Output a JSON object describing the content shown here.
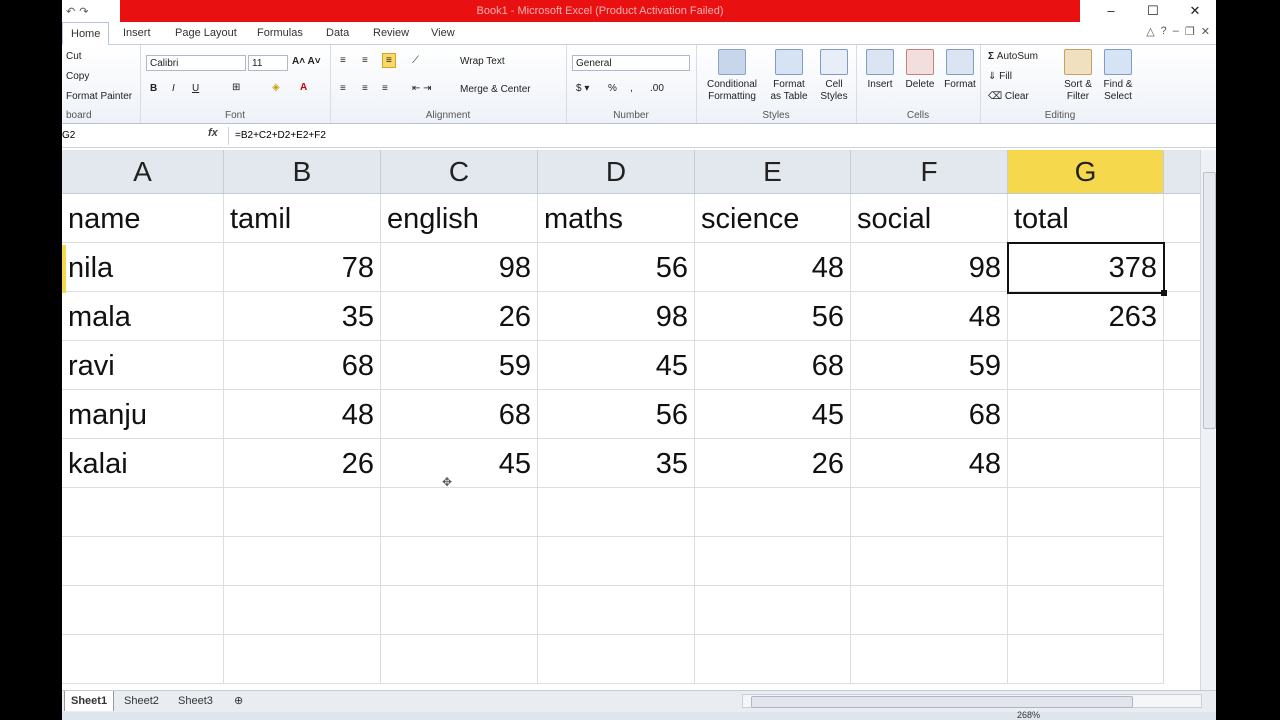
{
  "window": {
    "title": "Book1 - Microsoft Excel (Product Activation Failed)"
  },
  "qat": {
    "undo": "↶",
    "redo": "↷"
  },
  "tabs": [
    "Home",
    "Insert",
    "Page Layout",
    "Formulas",
    "Data",
    "Review",
    "View"
  ],
  "clipboard": {
    "cut": "Cut",
    "copy": "Copy",
    "format_painter": "Format Painter",
    "label": "board"
  },
  "font": {
    "name": "Calibri",
    "size": "11",
    "label": "Font"
  },
  "alignment": {
    "wrap": "Wrap Text",
    "merge": "Merge & Center",
    "label": "Alignment"
  },
  "number": {
    "format": "General",
    "label": "Number"
  },
  "styles": {
    "cond": [
      "Conditional",
      "Formatting"
    ],
    "table": [
      "Format",
      "as Table"
    ],
    "cell": [
      "Cell",
      "Styles"
    ],
    "label": "Styles"
  },
  "cells": {
    "insert": "Insert",
    "delete": "Delete",
    "format": "Format",
    "label": "Cells"
  },
  "editing": {
    "autosum": "AutoSum",
    "fill": "Fill",
    "clear": "Clear",
    "sort": [
      "Sort &",
      "Filter"
    ],
    "find": [
      "Find &",
      "Select"
    ],
    "label": "Editing"
  },
  "formula_bar": {
    "name_box": "G2",
    "fx": "fx",
    "formula": "=B2+C2+D2+E2+F2"
  },
  "columns": [
    "A",
    "B",
    "C",
    "D",
    "E",
    "F",
    "G"
  ],
  "rows": [
    [
      "name",
      "tamil",
      "english",
      "maths",
      "science",
      "social",
      "total"
    ],
    [
      "nila",
      "78",
      "98",
      "56",
      "48",
      "98",
      "378"
    ],
    [
      "mala",
      "35",
      "26",
      "98",
      "56",
      "48",
      "263"
    ],
    [
      "ravi",
      "68",
      "59",
      "45",
      "68",
      "59",
      ""
    ],
    [
      "manju",
      "48",
      "68",
      "56",
      "45",
      "68",
      ""
    ],
    [
      "kalai",
      "26",
      "45",
      "35",
      "26",
      "48",
      ""
    ]
  ],
  "sheets": [
    "Sheet1",
    "Sheet2",
    "Sheet3"
  ],
  "zoom": "268%",
  "colors": {
    "title_bar": "#e81010",
    "selected_header": "#f6d84c"
  }
}
